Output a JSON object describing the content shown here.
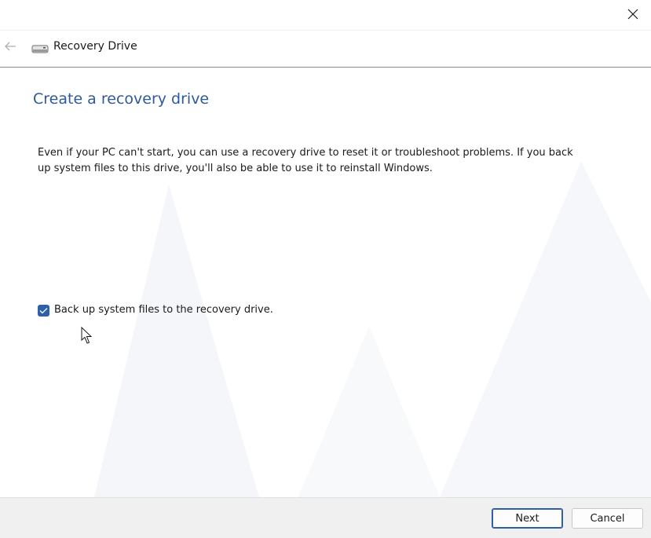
{
  "window": {
    "title": "Recovery Drive"
  },
  "icons": {
    "close": "close-icon",
    "back": "back-arrow-icon",
    "drive": "drive-icon"
  },
  "content": {
    "heading": "Create a recovery drive",
    "description": "Even if your PC can't start, you can use a recovery drive to reset it or troubleshoot problems. If you back up system files to this drive, you'll also be able to use it to reinstall Windows.",
    "backup_checkbox": {
      "label": "Back up system files to the recovery drive.",
      "checked": true
    }
  },
  "footer": {
    "next_label": "Next",
    "cancel_label": "Cancel"
  },
  "colors": {
    "heading": "#2d5a9a",
    "checkbox": "#2f5fa8",
    "primary_border": "#2f5fa8"
  }
}
